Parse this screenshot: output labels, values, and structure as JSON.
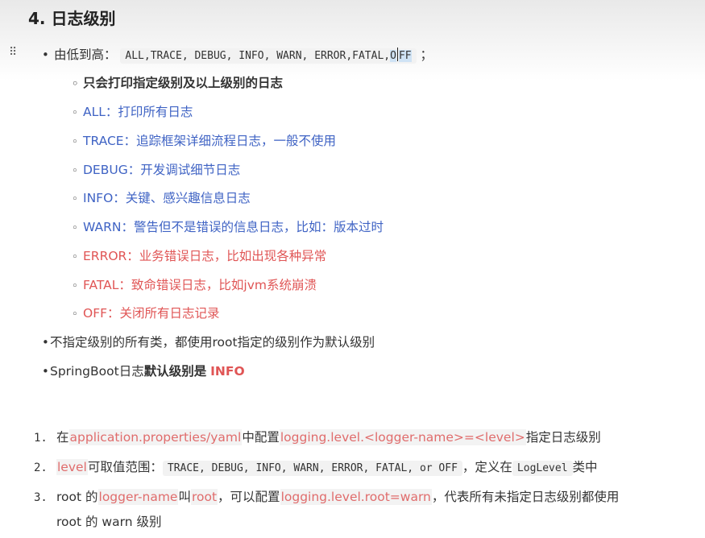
{
  "heading": "4. 日志级别",
  "colors": {
    "blue": "#3f63c4",
    "red": "#e05555",
    "highlight_bg": "#f3f3f3",
    "selection": "#cfe3f5"
  },
  "order_line": {
    "prefix": "由低到高：",
    "code_main": "ALL,TRACE, DEBUG, INFO, WARN, ERROR,FATAL,",
    "code_selected_a": "O",
    "code_selected_b": "FF",
    "suffix": "；"
  },
  "sub_items": [
    {
      "text": "只会打印指定级别及以上级别的日志",
      "color": "default",
      "bold": true
    },
    {
      "text": "ALL：打印所有日志",
      "color": "blue"
    },
    {
      "text": "TRACE：追踪框架详细流程日志，一般不使用",
      "color": "blue"
    },
    {
      "text": "DEBUG：开发调试细节日志",
      "color": "blue"
    },
    {
      "text": "INFO：关键、感兴趣信息日志",
      "color": "blue"
    },
    {
      "text": "WARN：警告但不是错误的信息日志，比如：版本过时",
      "color": "blue"
    },
    {
      "text": "ERROR：业务错误日志，比如出现各种异常",
      "color": "red"
    },
    {
      "text": "FATAL：致命错误日志，比如jvm系统崩溃",
      "color": "red"
    },
    {
      "text": "OFF：关闭所有日志记录",
      "color": "red"
    }
  ],
  "bullet2": "不指定级别的所有类，都使用root指定的级别作为默认级别",
  "bullet3": {
    "prefix": "SpringBoot日志",
    "bold": "默认级别是",
    "value": "INFO"
  },
  "numbered": {
    "item1": {
      "num": "1.",
      "t1": "在",
      "h1": "application.properties/yaml",
      "t2": "中配置",
      "h2": "logging.level.<logger-name>=<level>",
      "t3": "指定日志级别"
    },
    "item2": {
      "num": "2.",
      "h1": "level",
      "t1": "可取值范围：",
      "code1": "TRACE, DEBUG, INFO, WARN, ERROR, FATAL, or OFF",
      "t2": "，定义在",
      "code2": "LogLevel",
      "t3": "类中"
    },
    "item3": {
      "num": "3.",
      "t1": "root 的",
      "h1": "logger-name",
      "t2": "叫",
      "h2": "root",
      "t3": "，可以配置",
      "h3": "logging.level.root=warn",
      "t4": "，代表所有未指定日志级别都使用",
      "t5": "root 的 warn 级别"
    }
  }
}
